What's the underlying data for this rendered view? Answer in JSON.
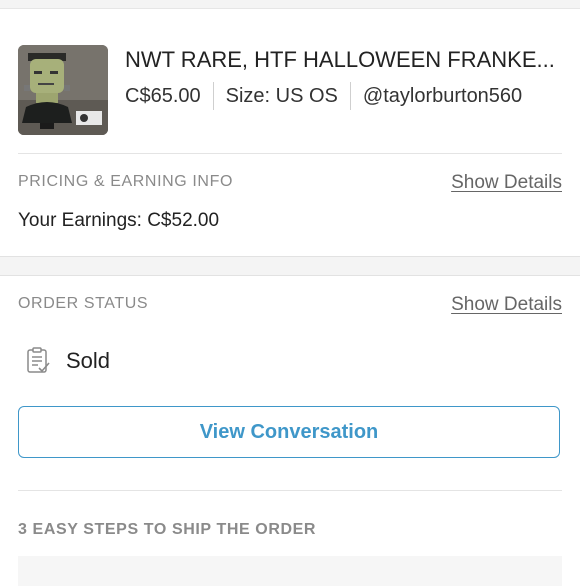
{
  "item": {
    "title": "NWT RARE, HTF HALLOWEEN FRANKE...",
    "price": "C$65.00",
    "size": "Size: US OS",
    "seller": "@taylorburton560"
  },
  "pricing": {
    "label": "PRICING & EARNING INFO",
    "show_details": "Show Details",
    "earnings": "Your Earnings: C$52.00"
  },
  "order_status": {
    "label": "ORDER STATUS",
    "show_details": "Show Details",
    "status": "Sold",
    "status_icon": "clipboard-check-icon",
    "button_label": "View Conversation"
  },
  "shipping": {
    "label": "3 EASY STEPS TO SHIP THE ORDER"
  },
  "colors": {
    "accent": "#3f97c9",
    "muted_text": "#8a8a8a",
    "divider": "#e4e4e4"
  }
}
